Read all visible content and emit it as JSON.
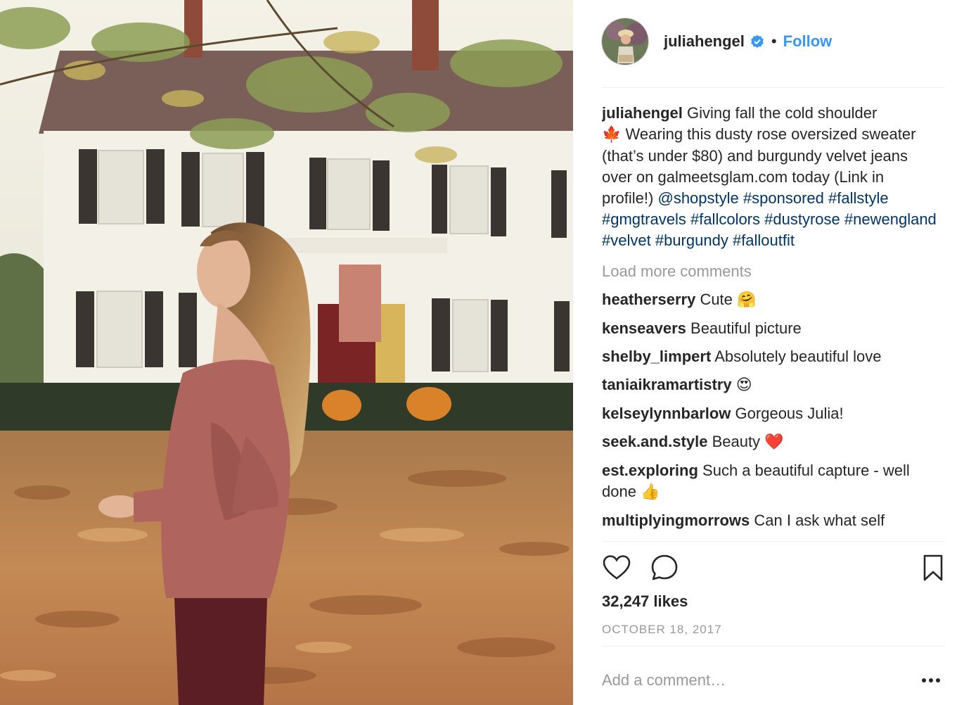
{
  "post": {
    "username": "juliahengel",
    "follow_label": "Follow",
    "separator": "•",
    "caption": {
      "username": "juliahengel",
      "text_part1": "Giving fall the cold shoulder",
      "emoji_leaf": "🍁",
      "text_part2": "Wearing this dusty rose oversized sweater (that’s under $80) and burgundy velvet jeans over on galmeetsglam.com today (Link in profile!)",
      "mention": "@shopstyle",
      "hashtags": [
        "#sponsored",
        "#fallstyle",
        "#gmgtravels",
        "#fallcolors",
        "#dustyrose",
        "#newengland",
        "#velvet",
        "#burgundy",
        "#falloutfit"
      ]
    },
    "load_more_label": "Load more comments",
    "comments": [
      {
        "user": "heatherserry",
        "text": "Cute",
        "emoji": "🤗"
      },
      {
        "user": "kenseavers",
        "text": "Beautiful picture",
        "emoji": ""
      },
      {
        "user": "shelby_limpert",
        "text": "Absolutely beautiful love",
        "emoji": ""
      },
      {
        "user": "taniaikramartistry",
        "text": "",
        "emoji": "😍"
      },
      {
        "user": "kelseylynnbarlow",
        "text": "Gorgeous Julia!",
        "emoji": ""
      },
      {
        "user": "seek.and.style",
        "text": "Beauty",
        "emoji": "❤️"
      },
      {
        "user": "est.exploring",
        "text": "Such a beautiful capture - well done",
        "emoji": "👍"
      },
      {
        "user": "multiplyingmorrows",
        "text": "Can I ask what self",
        "emoji": ""
      }
    ],
    "likes_label": "32,247 likes",
    "date_label": "OCTOBER 18, 2017",
    "add_comment_placeholder": "Add a comment…",
    "icons": {
      "verified": "verified-badge-icon",
      "like": "heart-icon",
      "comment": "speech-bubble-icon",
      "save": "bookmark-icon",
      "more": "more-dots-icon"
    }
  },
  "colors": {
    "link": "#003569",
    "follow": "#3897f0",
    "muted": "#999999",
    "text": "#262626",
    "divider": "#efefef"
  }
}
